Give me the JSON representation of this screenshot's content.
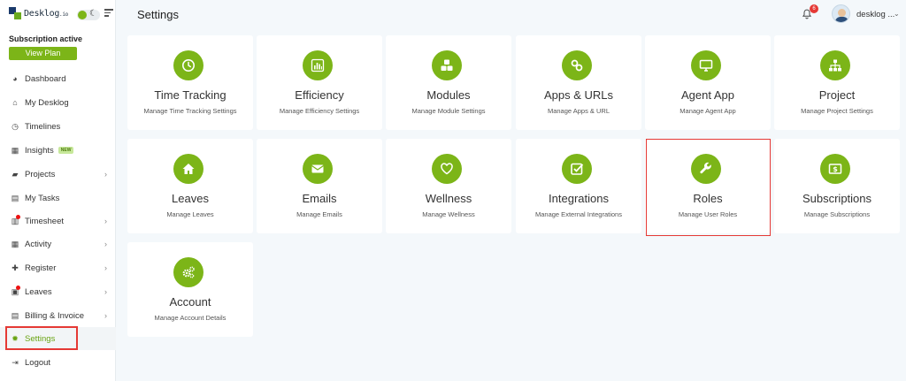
{
  "app": {
    "brand": "Desklog",
    "brand_suffix": ".io",
    "subscription_status": "Subscription active",
    "plan_button": "View Plan"
  },
  "sidebar": {
    "items": [
      {
        "label": "Dashboard",
        "icon": "palette-icon"
      },
      {
        "label": "My Desklog",
        "icon": "home-icon"
      },
      {
        "label": "Timelines",
        "icon": "clock-icon"
      },
      {
        "label": "Insights",
        "icon": "insights-icon",
        "badge": "NEW"
      },
      {
        "label": "Projects",
        "icon": "folder-icon"
      },
      {
        "label": "My Tasks",
        "icon": "tasks-icon"
      },
      {
        "label": "Timesheet",
        "icon": "timesheet-icon"
      },
      {
        "label": "Activity",
        "icon": "grid-icon"
      },
      {
        "label": "Register",
        "icon": "plus-icon"
      },
      {
        "label": "Leaves",
        "icon": "leaves-icon"
      },
      {
        "label": "Billing & Invoice",
        "icon": "invoice-icon"
      },
      {
        "label": "Settings",
        "icon": "gear-icon",
        "active": true
      },
      {
        "label": "Logout",
        "icon": "logout-icon"
      }
    ]
  },
  "header": {
    "title": "Settings",
    "notification_count": "6",
    "user_name": "desklog ..."
  },
  "cards": [
    {
      "title": "Time Tracking",
      "desc": "Manage Time Tracking Settings",
      "icon": "clock-icon"
    },
    {
      "title": "Efficiency",
      "desc": "Manage Efficiency Settings",
      "icon": "bar-chart-icon"
    },
    {
      "title": "Modules",
      "desc": "Manage Module Settings",
      "icon": "cubes-icon"
    },
    {
      "title": "Apps & URLs",
      "desc": "Manage Apps & URL",
      "icon": "link-icon"
    },
    {
      "title": "Agent App",
      "desc": "Manage Agent App",
      "icon": "monitor-icon"
    },
    {
      "title": "Project",
      "desc": "Manage Project Settings",
      "icon": "sitemap-icon"
    },
    {
      "title": "Leaves",
      "desc": "Manage Leaves",
      "icon": "home-icon"
    },
    {
      "title": "Emails",
      "desc": "Manage Emails",
      "icon": "envelope-icon"
    },
    {
      "title": "Wellness",
      "desc": "Manage Wellness",
      "icon": "heart-icon"
    },
    {
      "title": "Integrations",
      "desc": "Manage External Integrations",
      "icon": "check-square-icon"
    },
    {
      "title": "Roles",
      "desc": "Manage User Roles",
      "icon": "wrench-icon"
    },
    {
      "title": "Subscriptions",
      "desc": "Manage Subscriptions",
      "icon": "money-icon"
    },
    {
      "title": "Account",
      "desc": "Manage Account Details",
      "icon": "cogs-icon"
    }
  ],
  "colors": {
    "accent": "#7cb518",
    "highlight": "#e53935",
    "brand_dark": "#1a3a6b"
  }
}
